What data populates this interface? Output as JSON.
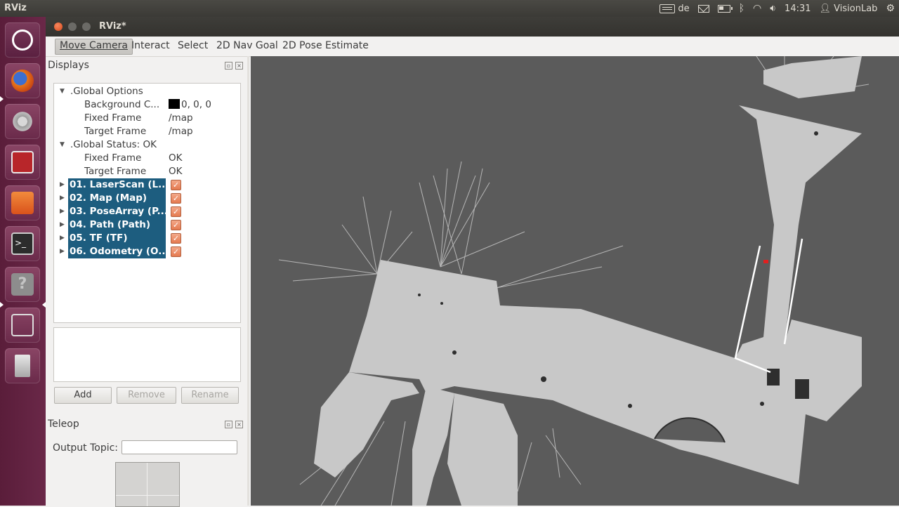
{
  "topbar": {
    "app_title": "RViz",
    "keyboard_layout": "de",
    "clock": "14:31",
    "user": "VisionLab"
  },
  "window": {
    "title": "RViz*"
  },
  "toolbar": {
    "tools": [
      "Move Camera",
      "Interact",
      "Select",
      "2D Nav Goal",
      "2D Pose Estimate"
    ],
    "active_tool": "Move Camera"
  },
  "displays": {
    "title": "Displays",
    "global_options": {
      "label": ".Global Options",
      "background_label": "Background C...",
      "background_value": "0, 0, 0",
      "background_color": "#000000",
      "fixed_frame_label": "Fixed Frame",
      "fixed_frame_value": "/map",
      "target_frame_label": "Target Frame",
      "target_frame_value": "/map"
    },
    "global_status": {
      "label": ".Global Status: OK",
      "fixed_frame_label": "Fixed Frame",
      "fixed_frame_value": "OK",
      "target_frame_label": "Target Frame",
      "target_frame_value": "OK"
    },
    "items": [
      {
        "label": "01. LaserScan (L...",
        "checked": true
      },
      {
        "label": "02. Map (Map)",
        "checked": true
      },
      {
        "label": "03. PoseArray (P...",
        "checked": true
      },
      {
        "label": "04. Path (Path)",
        "checked": true
      },
      {
        "label": "05. TF (TF)",
        "checked": true
      },
      {
        "label": "06. Odometry (O...",
        "checked": true
      }
    ],
    "buttons": {
      "add": "Add",
      "remove": "Remove",
      "rename": "Rename"
    }
  },
  "teleop": {
    "title": "Teleop",
    "output_topic_label": "Output Topic:",
    "output_topic_value": ""
  },
  "colors": {
    "selection": "#1d5d7f",
    "launcher": "#5a1d3a",
    "viewport_bg": "#5b5b5b",
    "map_free": "#c8c8c8",
    "robot_marker": "#e02020"
  }
}
